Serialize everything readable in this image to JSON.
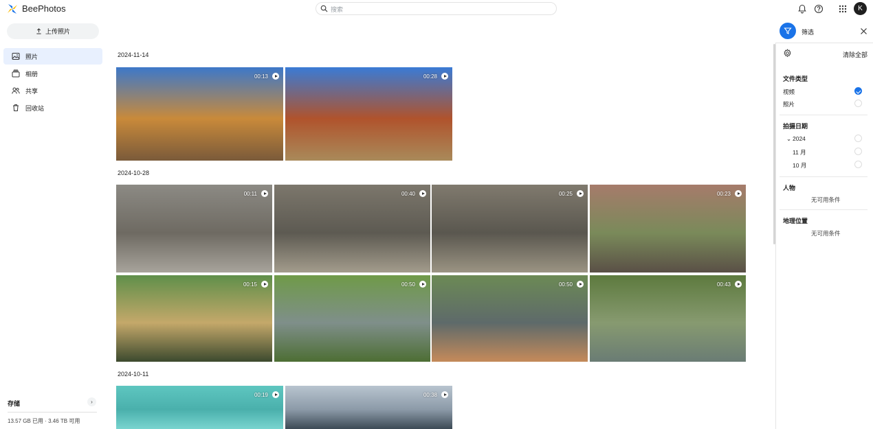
{
  "app": {
    "title": "BeePhotos",
    "avatar_letter": "K"
  },
  "search": {
    "placeholder": "搜索"
  },
  "sidebar": {
    "upload_label": "上传照片",
    "items": [
      {
        "label": "照片",
        "icon": "photo-icon",
        "active": true
      },
      {
        "label": "相册",
        "icon": "album-icon",
        "active": false
      },
      {
        "label": "共享",
        "icon": "people-icon",
        "active": false
      },
      {
        "label": "回收站",
        "icon": "trash-icon",
        "active": false
      }
    ],
    "storage": {
      "title": "存储",
      "usage": "13.57 GB 已用 · 3.46 TB 可用"
    }
  },
  "gallery": [
    {
      "date": "2024-11-14",
      "items": [
        {
          "duration": "00:13",
          "colors": [
            "#3d78c9",
            "#c98a3a",
            "#7a5a3a"
          ]
        },
        {
          "duration": "00:28",
          "colors": [
            "#3a7bd5",
            "#b0532c",
            "#a98a5a"
          ]
        }
      ]
    },
    {
      "date": "2024-10-28",
      "items": [
        {
          "duration": "00:11",
          "colors": [
            "#8c8a84",
            "#6e6a62",
            "#a7a39b"
          ]
        },
        {
          "duration": "00:40",
          "colors": [
            "#7c776c",
            "#5d5a52",
            "#a39c8c"
          ]
        },
        {
          "duration": "00:25",
          "colors": [
            "#807a6e",
            "#5a574f",
            "#9b9483"
          ]
        },
        {
          "duration": "00:23",
          "colors": [
            "#a67b6b",
            "#7a8a5a",
            "#5a5046"
          ]
        },
        {
          "duration": "00:15",
          "colors": [
            "#5f8f4a",
            "#c4a86a",
            "#3c4a2e"
          ]
        },
        {
          "duration": "00:50",
          "colors": [
            "#6f9a48",
            "#7f8f8a",
            "#4d6e34"
          ]
        },
        {
          "duration": "00:50",
          "colors": [
            "#6c8a55",
            "#5e6a6a",
            "#c58a5a"
          ]
        },
        {
          "duration": "00:43",
          "colors": [
            "#5d7a3e",
            "#879a70",
            "#6a7c74"
          ]
        }
      ]
    },
    {
      "date": "2024-10-11",
      "items": [
        {
          "duration": "00:19",
          "colors": [
            "#5ec6c0",
            "#4ab0ac",
            "#79d4cf"
          ]
        },
        {
          "duration": "00:38",
          "colors": [
            "#b8c4cf",
            "#8c9aa8",
            "#3c4a55"
          ]
        }
      ]
    }
  ],
  "filter_panel": {
    "title": "筛选",
    "clear_all": "清除全部",
    "file_type": {
      "title": "文件类型",
      "options": [
        {
          "label": "视频",
          "checked": true
        },
        {
          "label": "照片",
          "checked": false
        }
      ]
    },
    "date": {
      "title": "拍摄日期",
      "year": "2024",
      "months": [
        "11 月",
        "10 月"
      ]
    },
    "people": {
      "title": "人物",
      "empty": "无可用条件"
    },
    "location": {
      "title": "地理位置",
      "empty": "无可用条件"
    }
  }
}
